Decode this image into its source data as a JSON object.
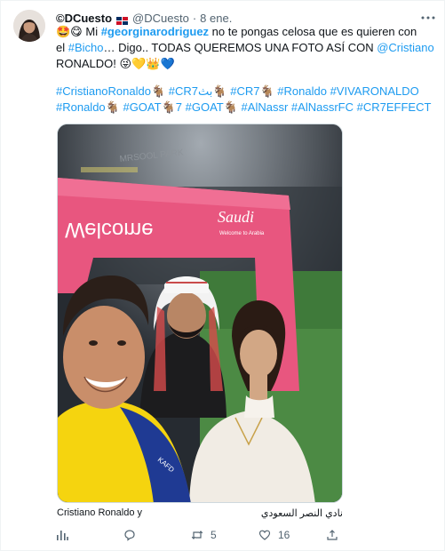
{
  "author": {
    "display_name": "©DCuesto",
    "handle": "@DCuesto",
    "separator": "·",
    "date": "8 ene."
  },
  "tweet": {
    "emoji_start": "🤩😋",
    "word_mi": " Mi ",
    "mention_georgina": "#georginarodriguez",
    "text_1": " no te pongas celosa que es quieren con",
    "text_el": "el ",
    "hashtag_bicho": "#Bicho",
    "text_2": "… Digo.. TODAS QUEREMOS UNA FOTO ASÍ CON ",
    "mention_cristiano": "@Cristiano",
    "text_3": "RONALDO! ",
    "emoji_end": "😜💛👑💙"
  },
  "hashtags": {
    "line1": [
      "#CristianoRonaldo🐐",
      "#CR7بث🐐",
      "#CR7🐐",
      "#Ronaldo",
      "#VIVARONALDO"
    ],
    "line2": [
      "#Ronaldo🐐",
      "#GOAT🐐7",
      "#GOAT🐐",
      "#AlNassr",
      "#AlNassrFC",
      "#CR7EFFECT"
    ]
  },
  "photo": {
    "arch_text_welcome": "Welcome",
    "arch_logo": "Saudi",
    "arch_logo_sub": "Welcome to Arabia",
    "stadium_sign": "MRSOOL PARK",
    "jersey_text": "KAFD"
  },
  "caption": {
    "left": "Cristiano Ronaldo y",
    "right": "نادي النصر السعودي"
  },
  "actions": {
    "views_label": "",
    "reply_count": "",
    "retweet_count": "5",
    "like_count": "16",
    "share_label": ""
  },
  "colors": {
    "accent": "#1d9bf0",
    "text": "#0f1419",
    "muted": "#536471",
    "arch_pink": "#e8567f",
    "jersey_yellow": "#f5d40f"
  }
}
